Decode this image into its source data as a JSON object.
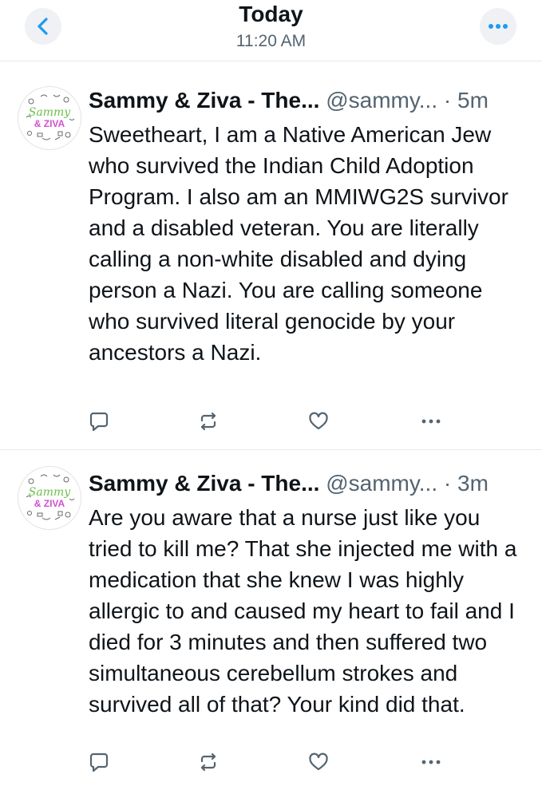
{
  "header": {
    "title": "Today",
    "time": "11:20 AM"
  },
  "colors": {
    "accent": "#1d9bf0",
    "icon_gray": "#536471",
    "avatar_pink": "#d24fd0",
    "avatar_green": "#6cc04a"
  },
  "posts": [
    {
      "display_name": "Sammy & Ziva - The...",
      "handle": "@sammy...",
      "sep": "·",
      "age": "5m",
      "avatar_text_top": "Sammy",
      "avatar_text_bottom": "& ZIVA",
      "text": "Sweetheart, I am a Native American Jew who survived the Indian Child Adoption Program. I also am an MMIWG2S survivor and a disabled veteran. You are literally calling a non-white disabled and dying person a Nazi. You are calling someone who survived literal genocide by your ancestors a Nazi."
    },
    {
      "display_name": "Sammy & Ziva - The...",
      "handle": "@sammy...",
      "sep": "·",
      "age": "3m",
      "avatar_text_top": "Sammy",
      "avatar_text_bottom": "& ZIVA",
      "text": "Are you aware that a nurse just like you tried to kill me? That she injected me with a medication that she knew I was highly allergic to and caused my heart to fail and I died for 3 minutes and then suffered two simultaneous cerebellum strokes and survived all of that? Your kind did that."
    }
  ],
  "icons": {
    "back": "chevron-left-icon",
    "more": "ellipsis-icon",
    "reply": "reply-icon",
    "repost": "repost-icon",
    "like": "heart-icon",
    "post_more": "ellipsis-icon"
  }
}
